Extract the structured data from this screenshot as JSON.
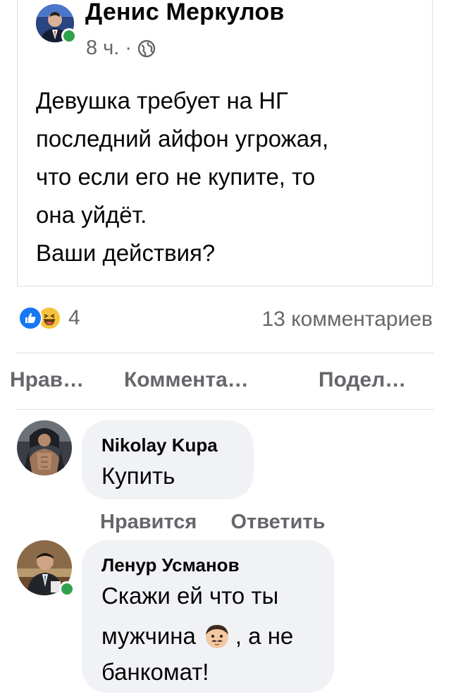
{
  "post": {
    "author": "Денис Меркулов",
    "time": "8 ч.",
    "separator": "·",
    "privacy_icon": "globe-icon",
    "text": "Девушка требует на НГ\nпоследний айфон угрожая,\nчто если его не купите, то\nона уйдёт.\nВаши действия?"
  },
  "reactions": {
    "icons": [
      "like-icon",
      "haha-icon"
    ],
    "count": "4",
    "comments_label": "13 комментариев"
  },
  "actions": {
    "like": "Нрав…",
    "comment": "Коммента…",
    "share": "Подел…"
  },
  "comments": [
    {
      "author": "Nikolay Kupa",
      "text": "Купить",
      "like": "Нравится",
      "reply": "Ответить"
    },
    {
      "author": "Ленур Усманов",
      "text_line1": "Скажи ей что ты",
      "text_line2_before": "мужчина",
      "text_line2_after": ", а не",
      "text_line3": "банкомат!",
      "emoji_icon": "man-emoji-icon"
    }
  ],
  "colors": {
    "online": "#31a24c",
    "like_blue": "#1877f2",
    "haha_yellow": "#f7c33c",
    "bubble": "#f0f2f5",
    "secondary_text": "#65676b"
  }
}
